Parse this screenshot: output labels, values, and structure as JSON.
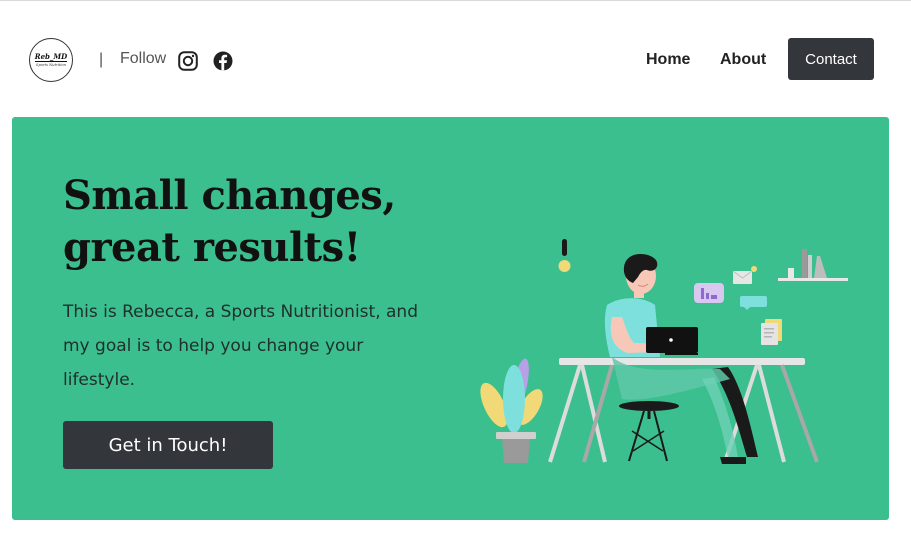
{
  "header": {
    "logo": {
      "main": "Reb_MD",
      "sub": "Sports Nutrition"
    },
    "separator": "|",
    "follow_label": "Follow",
    "social": [
      "instagram-icon",
      "facebook-icon"
    ],
    "nav": {
      "home": "Home",
      "about": "About",
      "contact": "Contact"
    }
  },
  "hero": {
    "headline_line1": "Small changes,",
    "headline_line2": "great results!",
    "intro": "This is Rebecca, a Sports Nutritionist, and my goal is to help you change your lifestyle.",
    "cta_label": "Get in Touch!",
    "illustration": "person-working-at-desk-illustration"
  },
  "colors": {
    "hero_bg": "#3bbf8f",
    "button_bg": "#33363b",
    "button_text": "#ffffff",
    "nav_text": "#222222"
  }
}
